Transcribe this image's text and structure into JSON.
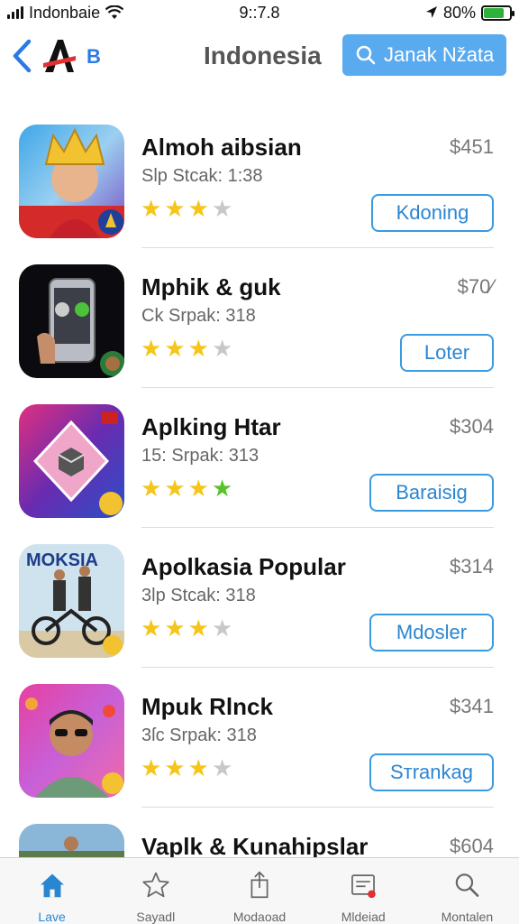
{
  "status": {
    "carrier": "Indonbaie",
    "time": "9::7.8",
    "battery": "80%",
    "battery_level": 0.8
  },
  "nav": {
    "b_label": "B",
    "title": "Indonesia",
    "search_label": "Janak Nžata"
  },
  "apps": [
    {
      "name": "Almoh aibsian",
      "sub": "Slp Stcak: 1:38",
      "price": "$451",
      "action": "Kdoning",
      "rating": 3,
      "icon": "king-portrait-icon"
    },
    {
      "name": "Mphik & guk",
      "sub": "Ck Srpak: 318",
      "price": "$70⁄",
      "action": "Loter",
      "rating": 3,
      "icon": "phone-app-icon"
    },
    {
      "name": "Aplking Htar",
      "sub": "15: Srpak: 313",
      "price": "$304",
      "action": "Baraisig",
      "rating": 4,
      "icon": "diamond-cube-icon"
    },
    {
      "name": "Apolkasia Popular",
      "sub": "3lp Stcak: 318",
      "price": "$314",
      "action": "Mdosler",
      "rating": 3,
      "icon": "bike-riders-icon"
    },
    {
      "name": "Mpuk Rlnck",
      "sub": "3ſc Srpak: 318",
      "price": "$341",
      "action": "Sтrankag",
      "rating": 3,
      "icon": "sunglasses-man-icon"
    },
    {
      "name": "Vaplk & Kunahipslar",
      "sub": "",
      "price": "$604",
      "action": "",
      "rating": 0,
      "icon": "landscape-icon"
    }
  ],
  "tabs": [
    {
      "label": "Lave",
      "icon": "home-icon"
    },
    {
      "label": "Sayadl",
      "icon": "star-icon"
    },
    {
      "label": "Modaoad",
      "icon": "share-icon"
    },
    {
      "label": "Mldeiad",
      "icon": "updates-icon"
    },
    {
      "label": "Montalen",
      "icon": "search-icon"
    }
  ],
  "colors": {
    "accent": "#2b86d1",
    "search_button": "#5aaaf0",
    "star_gold": "#f5c518",
    "star_green": "#57c22b",
    "star_empty": "#c8c8c8"
  }
}
